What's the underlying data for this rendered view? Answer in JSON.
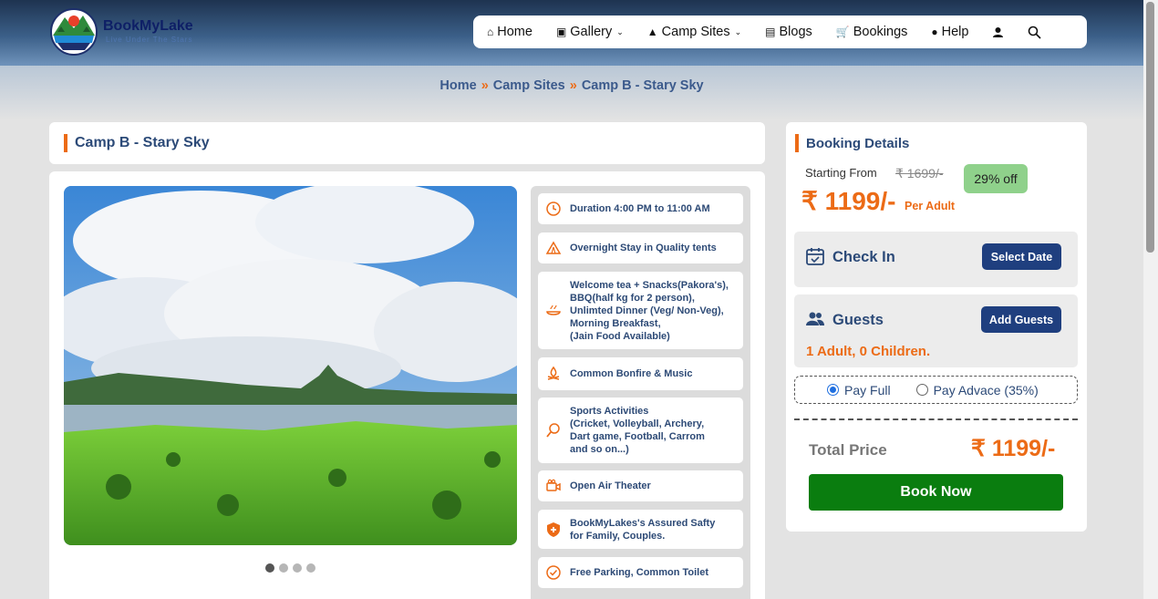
{
  "header": {
    "brand": "BookMyLake",
    "tagline": "Live Under The Stars",
    "nav": [
      {
        "label": "Home",
        "icon": "home-icon",
        "dropdown": false
      },
      {
        "label": "Gallery",
        "icon": "gallery-icon",
        "dropdown": true
      },
      {
        "label": "Camp Sites",
        "icon": "tent-icon",
        "dropdown": true
      },
      {
        "label": "Blogs",
        "icon": "blog-icon",
        "dropdown": false
      },
      {
        "label": "Bookings",
        "icon": "cart-icon",
        "dropdown": false
      },
      {
        "label": "Help",
        "icon": "help-icon",
        "dropdown": false
      }
    ],
    "icons": [
      "user-icon",
      "search-icon"
    ]
  },
  "breadcrumb": [
    "Home",
    "Camp Sites",
    "Camp B - Stary Sky"
  ],
  "camp": {
    "title": "Camp B - Stary Sky",
    "carousel": {
      "dots": 4,
      "active": 0
    },
    "amenities": [
      {
        "icon": "clock-icon",
        "text": "Duration 4:00 PM to 11:00 AM"
      },
      {
        "icon": "tent-icon",
        "text": "Overnight Stay in Quality tents"
      },
      {
        "icon": "food-icon",
        "text": "Welcome tea + Snacks(Pakora's),\nBBQ(half kg for 2 person),\nUnlimted Dinner (Veg/ Non-Veg),\nMorning Breakfast,\n(Jain Food Available)"
      },
      {
        "icon": "bonfire-icon",
        "text": "Common Bonfire & Music"
      },
      {
        "icon": "sports-icon",
        "text": "Sports Activities\n(Cricket, Volleyball, Archery,\nDart game, Football, Carrom\nand so on...)"
      },
      {
        "icon": "camera-icon",
        "text": "Open Air Theater"
      },
      {
        "icon": "shield-icon",
        "text": "BookMyLakes's Assured Safty\nfor Family, Couples."
      },
      {
        "icon": "check-circle-icon",
        "text": "Free Parking, Common Toilet"
      }
    ]
  },
  "booking": {
    "title": "Booking Details",
    "starting_from": "Starting From",
    "old_price": "₹ 1699/-",
    "discount": "29% off",
    "price": "₹ 1199/-",
    "per": "Per Adult",
    "checkin_label": "Check In",
    "checkin_button": "Select Date",
    "guests_label": "Guests",
    "guests_button": "Add Guests",
    "guests_value": "1 Adult, 0 Children.",
    "pay_full": "Pay Full",
    "pay_advance": "Pay Advace (35%)",
    "total_label": "Total Price",
    "total_value": "₹ 1199/-",
    "book_button": "Book Now"
  },
  "colors": {
    "accent": "#ec6b16",
    "navy": "#1f3f7f",
    "green": "#0a7d0f",
    "title": "#2c4a78"
  }
}
